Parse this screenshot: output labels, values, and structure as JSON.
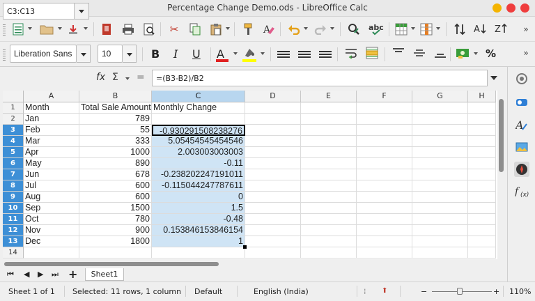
{
  "window": {
    "title": "Percentage Change Demo.ods - LibreOffice Calc"
  },
  "toolbar": {
    "font_name": "Liberation Sans",
    "font_size": "10",
    "bold": "B",
    "italic": "I",
    "underline": "U",
    "font_color_glyph": "A",
    "percent_glyph": "%",
    "font_color": "#e02020",
    "highlight_color": "#ffff00"
  },
  "formula_bar": {
    "name_box": "C3:C13",
    "fx": "fx",
    "sigma": "Σ",
    "equals": "=",
    "formula": "=(B3-B2)/B2"
  },
  "grid": {
    "columns": [
      "A",
      "B",
      "C",
      "D",
      "E",
      "F",
      "G",
      "H"
    ],
    "selected_column": "C",
    "rows": [
      {
        "num": "1",
        "a": "Month",
        "b": "Total Sale Amount",
        "c": "Monthly Change"
      },
      {
        "num": "2",
        "a": "Jan",
        "b": "789",
        "c": ""
      },
      {
        "num": "3",
        "a": "Feb",
        "b": "55",
        "c": "-0.930291508238276"
      },
      {
        "num": "4",
        "a": "Mar",
        "b": "333",
        "c": "5.05454545454546"
      },
      {
        "num": "5",
        "a": "Apr",
        "b": "1000",
        "c": "2.003003003003"
      },
      {
        "num": "6",
        "a": "May",
        "b": "890",
        "c": "-0.11"
      },
      {
        "num": "7",
        "a": "Jun",
        "b": "678",
        "c": "-0.238202247191011"
      },
      {
        "num": "8",
        "a": "Jul",
        "b": "600",
        "c": "-0.115044247787611"
      },
      {
        "num": "9",
        "a": "Aug",
        "b": "600",
        "c": "0"
      },
      {
        "num": "10",
        "a": "Sep",
        "b": "1500",
        "c": "1.5"
      },
      {
        "num": "11",
        "a": "Oct",
        "b": "780",
        "c": "-0.48"
      },
      {
        "num": "12",
        "a": "Nov",
        "b": "900",
        "c": "0.153846153846154"
      },
      {
        "num": "13",
        "a": "Dec",
        "b": "1800",
        "c": "1"
      },
      {
        "num": "14",
        "a": "",
        "b": "",
        "c": ""
      }
    ]
  },
  "sheet_tabs": {
    "add": "+",
    "tabs": [
      "Sheet1"
    ]
  },
  "status_bar": {
    "sheet_info": "Sheet 1 of 1",
    "selection": "Selected: 11 rows, 1 column",
    "page_style": "Default",
    "language": "English (India)",
    "zoom_minus": "−",
    "zoom_plus": "+",
    "zoom_level": "110%"
  },
  "sidebar": {
    "icons": [
      "properties-icon",
      "styles-icon",
      "gallery-icon",
      "navigator-icon",
      "functions-icon"
    ]
  }
}
